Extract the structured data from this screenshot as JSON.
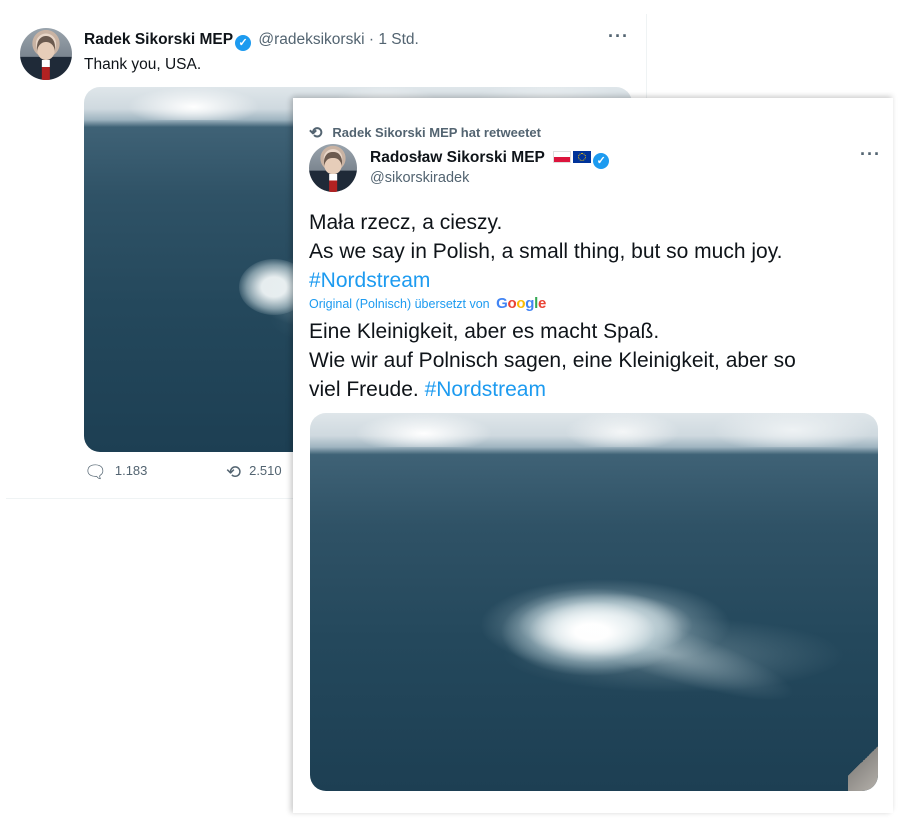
{
  "back_tweet": {
    "author_name": "Radek Sikorski MEP",
    "verified_mark": "✓",
    "handle": "@radeksikorski",
    "separator": "·",
    "time": "1 Std.",
    "more_label": "···",
    "text": "Thank you, USA.",
    "image": "aerial-sea-gas-leak-photo",
    "reply_count": "1.183",
    "retweet_count": "2.510"
  },
  "front_tweet": {
    "retweet_notice": "Radek Sikorski MEP hat retweetet",
    "author_name": "Radosław Sikorski MEP",
    "flags": [
      "flag-poland",
      "flag-eu"
    ],
    "verified_mark": "✓",
    "handle": "@sikorskiradek",
    "more_label": "···",
    "original_line1": "Mała rzecz, a cieszy.",
    "original_line2": "As we say in Polish, a small thing, but so much joy.",
    "original_hashtag": "#Nordstream",
    "translation_notice": "Original (Polnisch) übersetzt von",
    "translator_logo": {
      "G": "G",
      "o1": "o",
      "o2": "o",
      "g": "g",
      "l": "l",
      "e": "e"
    },
    "translated_line1": "Eine Kleinigkeit, aber es macht Spaß.",
    "translated_line2": "Wie wir auf Polnisch sagen, eine Kleinigkeit, aber so",
    "translated_line3": "viel Freude.",
    "translated_hashtag": "#Nordstream",
    "image": "aerial-sea-gas-leak-photo"
  },
  "colors": {
    "link_blue": "#1d9bf0",
    "secondary_text": "#536471",
    "primary_text": "#0f1419"
  }
}
